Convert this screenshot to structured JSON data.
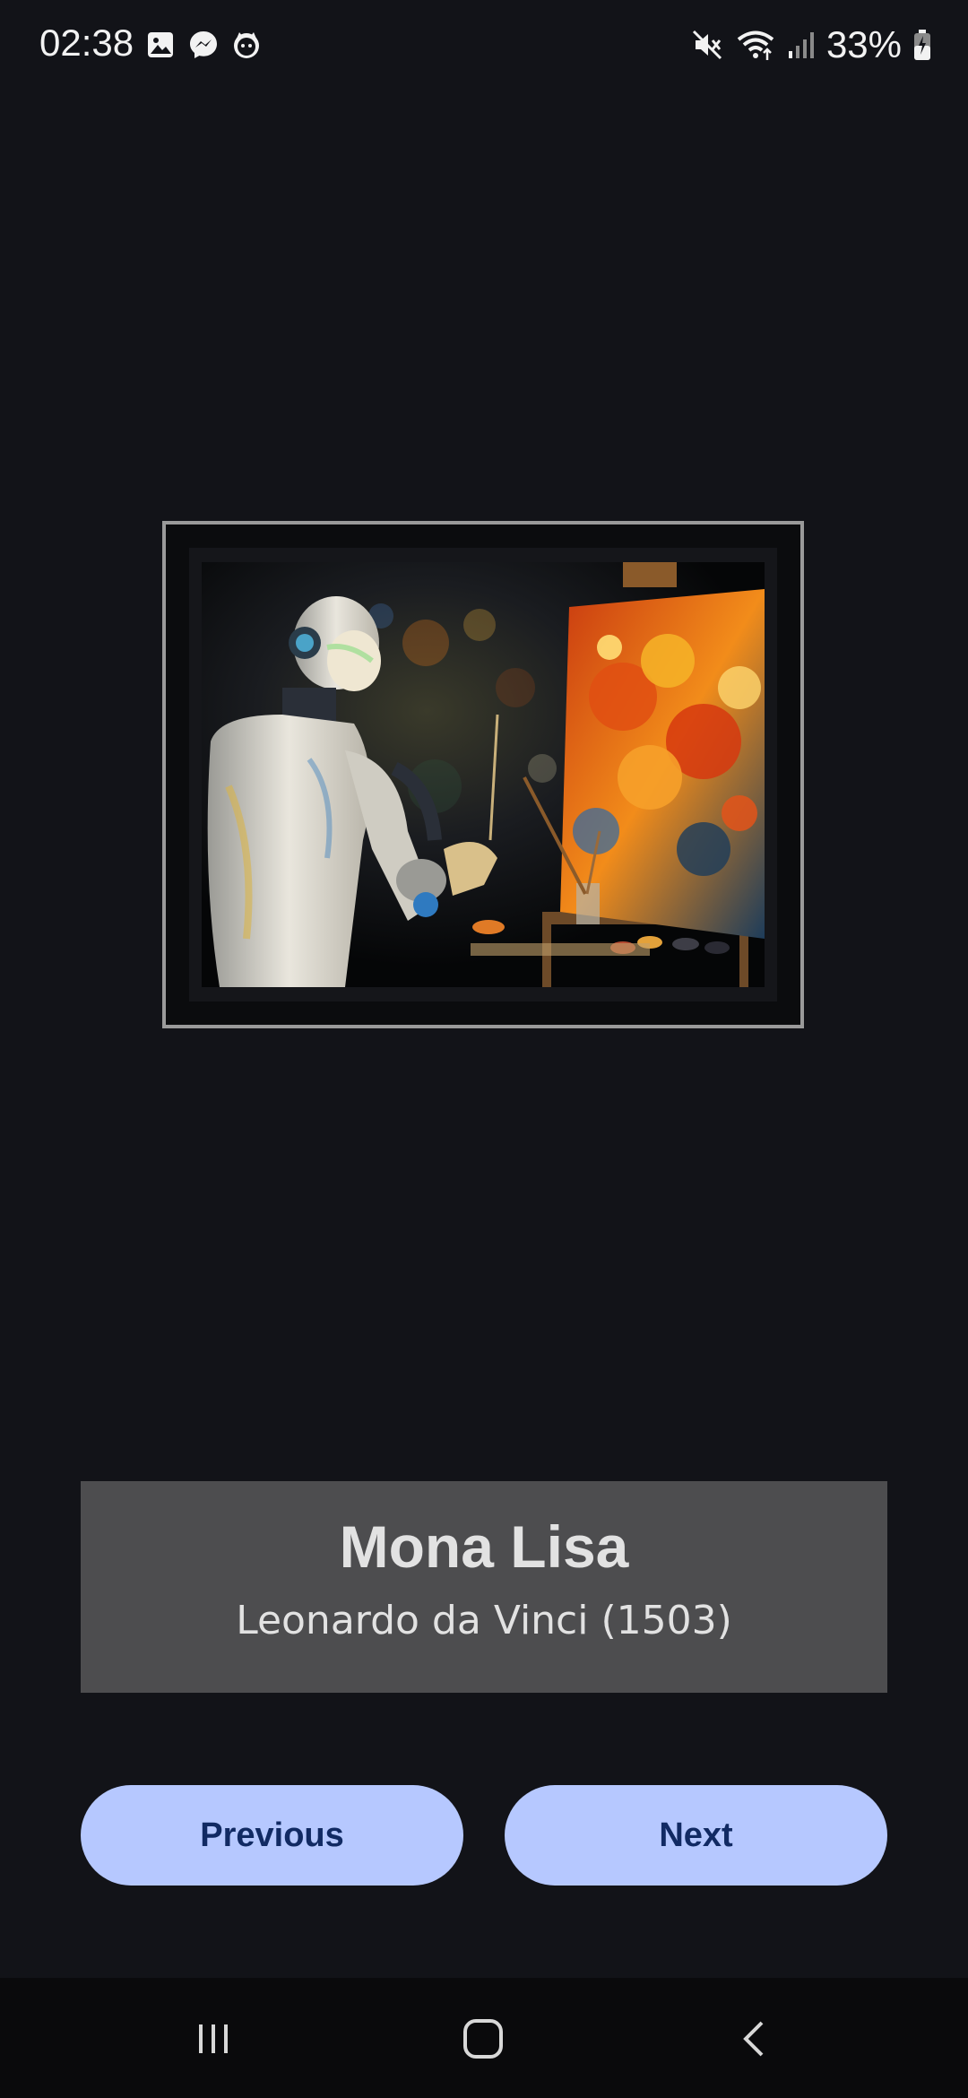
{
  "status_bar": {
    "time": "02:38",
    "left_icons": [
      "gallery-icon",
      "messenger-icon",
      "cat-face-icon"
    ],
    "right_icons": [
      "mute-icon",
      "wifi-icon",
      "signal-icon",
      "battery-icon"
    ],
    "battery": "33%"
  },
  "artwork": {
    "image_name": "robot-painter-image",
    "frame_color": "#9a9a9a"
  },
  "info": {
    "title": "Mona Lisa",
    "subtitle": "Leonardo da Vinci (1503)"
  },
  "buttons": {
    "previous_label": "Previous",
    "next_label": "Next",
    "color": "#b6c8ff",
    "text_color": "#112a63"
  },
  "nav": {
    "icons": [
      "recents-icon",
      "home-icon",
      "back-icon"
    ]
  },
  "colors": {
    "background": "#121318",
    "card": "#4d4d4f"
  }
}
